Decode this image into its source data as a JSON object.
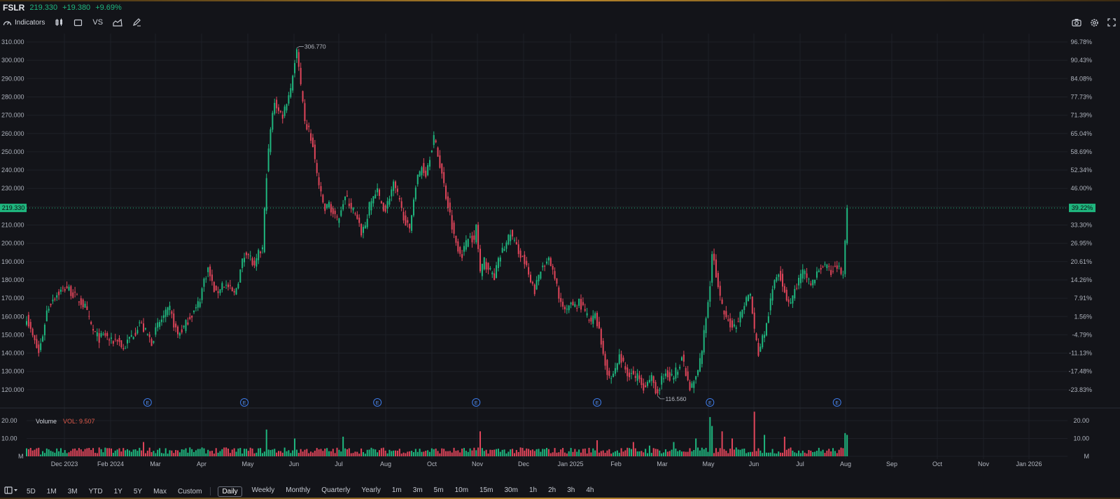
{
  "header": {
    "symbol": "FSLR",
    "price": "219.330",
    "change": "+19.380",
    "change_pct": "+9.69%"
  },
  "toolbar": {
    "indicators_label": "Indicators",
    "vs_label": "VS"
  },
  "price_axis": [
    "310.000",
    "300.000",
    "290.000",
    "280.000",
    "270.000",
    "260.000",
    "250.000",
    "240.000",
    "230.000",
    "220.000",
    "210.000",
    "200.000",
    "190.000",
    "180.000",
    "170.000",
    "160.000",
    "150.000",
    "140.000",
    "130.000",
    "120.000"
  ],
  "pct_axis": [
    "96.78%",
    "90.43%",
    "84.08%",
    "77.73%",
    "71.39%",
    "65.04%",
    "58.69%",
    "52.34%",
    "46.00%",
    "39.22%",
    "33.30%",
    "26.95%",
    "20.61%",
    "14.26%",
    "7.91%",
    "1.56%",
    "-4.79%",
    "-11.13%",
    "-17.48%",
    "-23.83%"
  ],
  "pct_hidden_index": 9,
  "current_price_label": "219.330",
  "current_pct_label": "39.22%",
  "high_label": "306.770",
  "low_label": "116.560",
  "earnings_marker": "E",
  "volume": {
    "title": "Volume",
    "vol_label": "VOL: 9.507",
    "axis": [
      "20.00",
      "10.00",
      "M"
    ]
  },
  "time_axis": [
    "Dec 2023",
    "Feb 2024",
    "Mar",
    "Apr",
    "May",
    "Jun",
    "Jul",
    "Aug",
    "Oct",
    "Nov",
    "Dec",
    "Jan 2025",
    "Feb",
    "Mar",
    "May",
    "Jun",
    "Jul",
    "Aug",
    "Sep",
    "Oct",
    "Nov",
    "Jan 2026"
  ],
  "ranges": [
    "5D",
    "1M",
    "3M",
    "YTD",
    "1Y",
    "5Y",
    "Max",
    "Custom"
  ],
  "intervals": [
    "Daily",
    "Weekly",
    "Monthly",
    "Quarterly",
    "Yearly",
    "1m",
    "3m",
    "5m",
    "10m",
    "15m",
    "30m",
    "1h",
    "2h",
    "3h",
    "4h"
  ],
  "active_interval": "Daily",
  "colors": {
    "up": "#1fb67e",
    "down": "#e0455a",
    "bg": "#131419",
    "grid": "#1e2027"
  },
  "chart_data": {
    "type": "candlestick",
    "title": "FSLR",
    "ylim": [
      113,
      312
    ],
    "close_path": [
      [
        0,
        160
      ],
      [
        2,
        152
      ],
      [
        4,
        146
      ],
      [
        6,
        140
      ],
      [
        8,
        150
      ],
      [
        10,
        163
      ],
      [
        13,
        170
      ],
      [
        17,
        174
      ],
      [
        20,
        176
      ],
      [
        23,
        172
      ],
      [
        26,
        169
      ],
      [
        29,
        165
      ],
      [
        31,
        158
      ],
      [
        33,
        152
      ],
      [
        36,
        148
      ],
      [
        39,
        150
      ],
      [
        42,
        146
      ],
      [
        45,
        148
      ],
      [
        48,
        142
      ],
      [
        51,
        148
      ],
      [
        54,
        152
      ],
      [
        56,
        157
      ],
      [
        58,
        153
      ],
      [
        60,
        150
      ],
      [
        62,
        146
      ],
      [
        65,
        155
      ],
      [
        68,
        160
      ],
      [
        71,
        164
      ],
      [
        73,
        156
      ],
      [
        75,
        150
      ],
      [
        78,
        154
      ],
      [
        81,
        160
      ],
      [
        84,
        164
      ],
      [
        86,
        170
      ],
      [
        88,
        180
      ],
      [
        90,
        186
      ],
      [
        92,
        178
      ],
      [
        94,
        172
      ],
      [
        97,
        178
      ],
      [
        100,
        176
      ],
      [
        103,
        172
      ],
      [
        105,
        180
      ],
      [
        107,
        190
      ],
      [
        109,
        196
      ],
      [
        111,
        192
      ],
      [
        113,
        186
      ],
      [
        115,
        194
      ],
      [
        117,
        197
      ],
      [
        119,
        238
      ],
      [
        121,
        262
      ],
      [
        123,
        278
      ],
      [
        125,
        272
      ],
      [
        127,
        270
      ],
      [
        129,
        278
      ],
      [
        131,
        285
      ],
      [
        133,
        300
      ],
      [
        134,
        306
      ],
      [
        136,
        285
      ],
      [
        138,
        265
      ],
      [
        140,
        262
      ],
      [
        142,
        252
      ],
      [
        144,
        238
      ],
      [
        146,
        226
      ],
      [
        148,
        218
      ],
      [
        150,
        222
      ],
      [
        152,
        216
      ],
      [
        154,
        212
      ],
      [
        156,
        220
      ],
      [
        158,
        225
      ],
      [
        160,
        222
      ],
      [
        162,
        218
      ],
      [
        164,
        212
      ],
      [
        166,
        206
      ],
      [
        168,
        210
      ],
      [
        170,
        220
      ],
      [
        172,
        226
      ],
      [
        174,
        228
      ],
      [
        176,
        222
      ],
      [
        178,
        218
      ],
      [
        180,
        226
      ],
      [
        182,
        232
      ],
      [
        184,
        226
      ],
      [
        186,
        218
      ],
      [
        188,
        212
      ],
      [
        190,
        206
      ],
      [
        192,
        226
      ],
      [
        194,
        236
      ],
      [
        196,
        242
      ],
      [
        198,
        238
      ],
      [
        200,
        248
      ],
      [
        202,
        258
      ],
      [
        204,
        248
      ],
      [
        206,
        238
      ],
      [
        208,
        226
      ],
      [
        210,
        216
      ],
      [
        212,
        204
      ],
      [
        214,
        198
      ],
      [
        216,
        194
      ],
      [
        218,
        200
      ],
      [
        220,
        206
      ],
      [
        222,
        200
      ],
      [
        223,
        210
      ],
      [
        225,
        184
      ],
      [
        227,
        190
      ],
      [
        229,
        186
      ],
      [
        232,
        182
      ],
      [
        234,
        190
      ],
      [
        236,
        196
      ],
      [
        238,
        200
      ],
      [
        240,
        206
      ],
      [
        242,
        200
      ],
      [
        244,
        196
      ],
      [
        246,
        192
      ],
      [
        248,
        186
      ],
      [
        250,
        178
      ],
      [
        252,
        174
      ],
      [
        254,
        182
      ],
      [
        256,
        188
      ],
      [
        258,
        192
      ],
      [
        260,
        188
      ],
      [
        262,
        180
      ],
      [
        264,
        172
      ],
      [
        266,
        164
      ],
      [
        268,
        162
      ],
      [
        270,
        168
      ],
      [
        272,
        166
      ],
      [
        274,
        168
      ],
      [
        276,
        164
      ],
      [
        278,
        160
      ],
      [
        280,
        156
      ],
      [
        282,
        162
      ],
      [
        284,
        152
      ],
      [
        286,
        140
      ],
      [
        288,
        130
      ],
      [
        290,
        126
      ],
      [
        292,
        132
      ],
      [
        294,
        138
      ],
      [
        296,
        134
      ],
      [
        298,
        128
      ],
      [
        300,
        130
      ],
      [
        302,
        126
      ],
      [
        304,
        128
      ],
      [
        306,
        122
      ],
      [
        308,
        124
      ],
      [
        310,
        126
      ],
      [
        312,
        120
      ],
      [
        313,
        118
      ],
      [
        315,
        126
      ],
      [
        317,
        130
      ],
      [
        319,
        126
      ],
      [
        321,
        128
      ],
      [
        323,
        132
      ],
      [
        325,
        138
      ],
      [
        327,
        128
      ],
      [
        329,
        120
      ],
      [
        331,
        124
      ],
      [
        333,
        130
      ],
      [
        335,
        142
      ],
      [
        337,
        160
      ],
      [
        339,
        178
      ],
      [
        340,
        196
      ],
      [
        341,
        190
      ],
      [
        343,
        175
      ],
      [
        345,
        165
      ],
      [
        347,
        158
      ],
      [
        349,
        156
      ],
      [
        351,
        155
      ],
      [
        353,
        158
      ],
      [
        355,
        164
      ],
      [
        357,
        170
      ],
      [
        359,
        172
      ],
      [
        361,
        152
      ],
      [
        363,
        140
      ],
      [
        365,
        148
      ],
      [
        367,
        155
      ],
      [
        369,
        168
      ],
      [
        371,
        180
      ],
      [
        373,
        185
      ],
      [
        375,
        178
      ],
      [
        377,
        170
      ],
      [
        379,
        168
      ],
      [
        381,
        174
      ],
      [
        383,
        180
      ],
      [
        385,
        184
      ],
      [
        387,
        182
      ],
      [
        389,
        178
      ],
      [
        391,
        180
      ],
      [
        393,
        186
      ],
      [
        395,
        188
      ],
      [
        397,
        186
      ],
      [
        399,
        184
      ],
      [
        401,
        188
      ],
      [
        403,
        186
      ],
      [
        405,
        182
      ],
      [
        406,
        200
      ],
      [
        407,
        219.33
      ]
    ],
    "last_close": 219.33,
    "high": 306.77,
    "low": 116.56,
    "earnings_at": [
      60,
      108,
      174,
      223,
      283,
      339,
      402
    ],
    "volume_spikes": [
      [
        7,
        1
      ],
      [
        58,
        8
      ],
      [
        119,
        15
      ],
      [
        133,
        10
      ],
      [
        157,
        11
      ],
      [
        225,
        14
      ],
      [
        283,
        9
      ],
      [
        301,
        8
      ],
      [
        309,
        6
      ],
      [
        321,
        8
      ],
      [
        332,
        10
      ],
      [
        339,
        22
      ],
      [
        340,
        17
      ],
      [
        345,
        14
      ],
      [
        350,
        10
      ],
      [
        361,
        25
      ],
      [
        366,
        12
      ],
      [
        376,
        11
      ],
      [
        406,
        13
      ],
      [
        407,
        12
      ]
    ]
  }
}
